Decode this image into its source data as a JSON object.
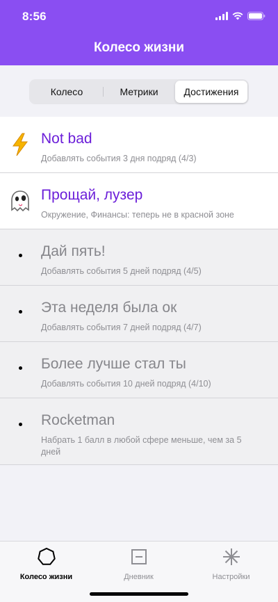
{
  "status": {
    "time": "8:56"
  },
  "nav": {
    "title": "Колесо жизни"
  },
  "segments": {
    "items": [
      {
        "label": "Колесо"
      },
      {
        "label": "Метрики"
      },
      {
        "label": "Достижения"
      }
    ],
    "selected": "Достижения"
  },
  "achievements": [
    {
      "title": "Not bad",
      "subtitle": "Добавлять события 3 дня подряд (4/3)",
      "icon": "lightning-emoji",
      "unlocked": true
    },
    {
      "title": "Прощай, лузер",
      "subtitle": "Окружение, Финансы: теперь не в красной зоне",
      "icon": "ghost-emoji",
      "unlocked": true
    },
    {
      "title": "Дай пять!",
      "subtitle": "Добавлять события 5 дней подряд (4/5)",
      "icon": "bullet",
      "unlocked": false
    },
    {
      "title": "Эта неделя была ок",
      "subtitle": "Добавлять события 7 дней подряд (4/7)",
      "icon": "bullet",
      "unlocked": false
    },
    {
      "title": "Более лучше стал ты",
      "subtitle": "Добавлять события 10 дней подряд (4/10)",
      "icon": "bullet",
      "unlocked": false
    },
    {
      "title": "Rocketman",
      "subtitle": "Набрать 1 балл в любой сфере меньше, чем за 5 дней",
      "icon": "bullet",
      "unlocked": false
    }
  ],
  "tabbar": {
    "items": [
      {
        "label": "Колесо жизни",
        "icon": "heptagon-icon",
        "active": true
      },
      {
        "label": "Дневник",
        "icon": "minus-square-icon",
        "active": false
      },
      {
        "label": "Настройки",
        "icon": "asterisk-icon",
        "active": false
      }
    ]
  },
  "colors": {
    "accent": "#8a4ef2",
    "unlocked_title": "#6b1ed9",
    "locked_title": "#86868b"
  }
}
